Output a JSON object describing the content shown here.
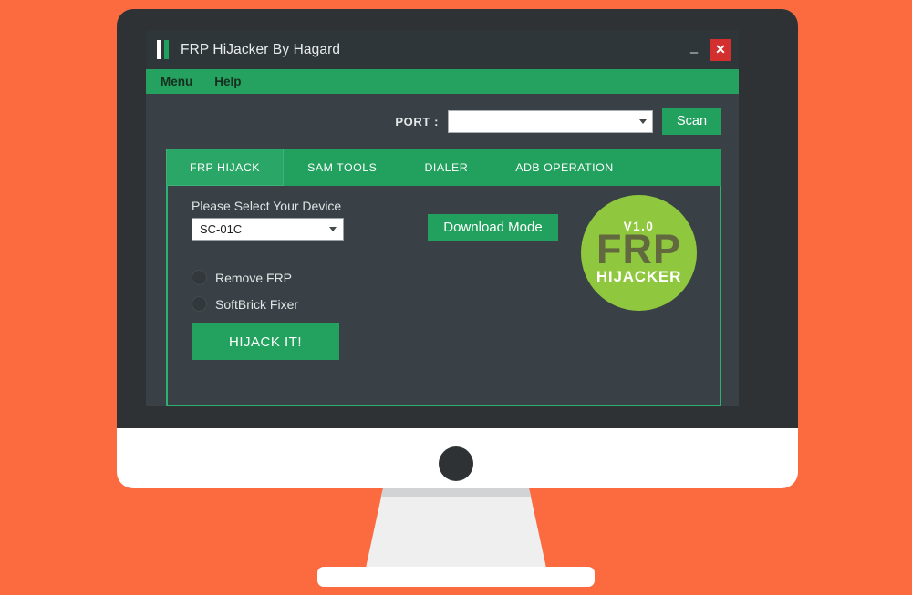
{
  "scene": {
    "background_color": "#fc6b3f",
    "monitor_frame_color": "#2f3234",
    "monitor_chin_color": "#ffffff",
    "monitor_stand_color": "#efeff0"
  },
  "app": {
    "title": "FRP HiJacker By Hagard",
    "logo_icon": "two-bars-icon",
    "window_bg": "#3a4146",
    "accent_green": "#22a05d",
    "controls": {
      "minimize_label": "–",
      "minimize_icon": "minimize-icon",
      "close_label": "✕",
      "close_icon": "close-icon",
      "close_color": "#d32f2f"
    },
    "menu": {
      "items": [
        {
          "label": "Menu"
        },
        {
          "label": "Help"
        }
      ]
    },
    "port_row": {
      "label": "PORT :",
      "select_value": "",
      "select_placeholder": "",
      "dropdown_icon": "chevron-down-icon",
      "scan_label": "Scan"
    },
    "tabs": [
      {
        "label": "FRP HIJACK",
        "active": true
      },
      {
        "label": "SAM TOOLS",
        "active": false
      },
      {
        "label": "DIALER",
        "active": false
      },
      {
        "label": "ADB OPERATION",
        "active": false
      }
    ],
    "frp_hijack_panel": {
      "device_label": "Please Select Your Device",
      "device_value": "SC-01C",
      "device_dropdown_icon": "chevron-down-icon",
      "download_mode_label": "Download Mode",
      "options": [
        {
          "label": "Remove FRP",
          "selected": false
        },
        {
          "label": "SoftBrick Fixer",
          "selected": false
        }
      ],
      "hijack_label": "HIJACK IT!",
      "logo": {
        "version": "V1.0",
        "main": "FRP",
        "sub": "HIJACKER",
        "circle_color": "#8fc73f",
        "main_text_color": "#63693f"
      }
    }
  }
}
